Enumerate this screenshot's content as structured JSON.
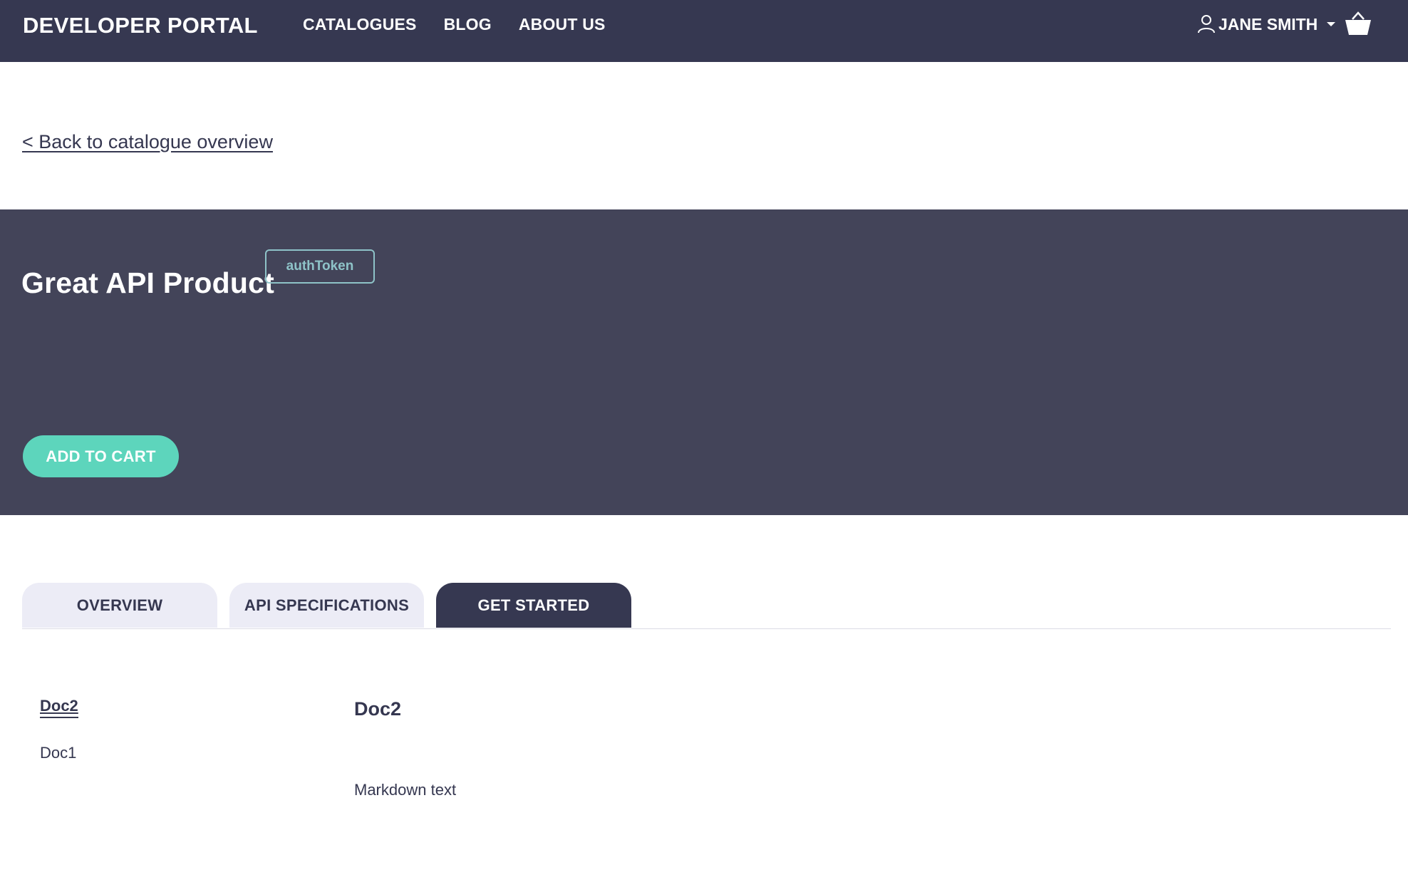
{
  "header": {
    "brand": "DEVELOPER PORTAL",
    "nav": [
      "CATALOGUES",
      "BLOG",
      "ABOUT US"
    ],
    "user_name": "JANE SMITH",
    "user_icon": "user-icon",
    "cart_icon": "basket-icon"
  },
  "back_link": "< Back to catalogue overview",
  "product": {
    "title": "Great API Product",
    "badge": "authToken",
    "add_to_cart": "ADD TO CART"
  },
  "tabs": [
    {
      "label": "OVERVIEW",
      "active": false
    },
    {
      "label": "API SPECIFICATIONS",
      "active": false
    },
    {
      "label": "GET STARTED",
      "active": true
    }
  ],
  "docs_nav": [
    "Doc2",
    "Doc1"
  ],
  "doc": {
    "title": "Doc2",
    "body": "Markdown text"
  },
  "colors": {
    "header_bg": "#363851",
    "hero_bg": "#434459",
    "accent": "#5dd5bc",
    "badge": "#8ec3c8"
  }
}
